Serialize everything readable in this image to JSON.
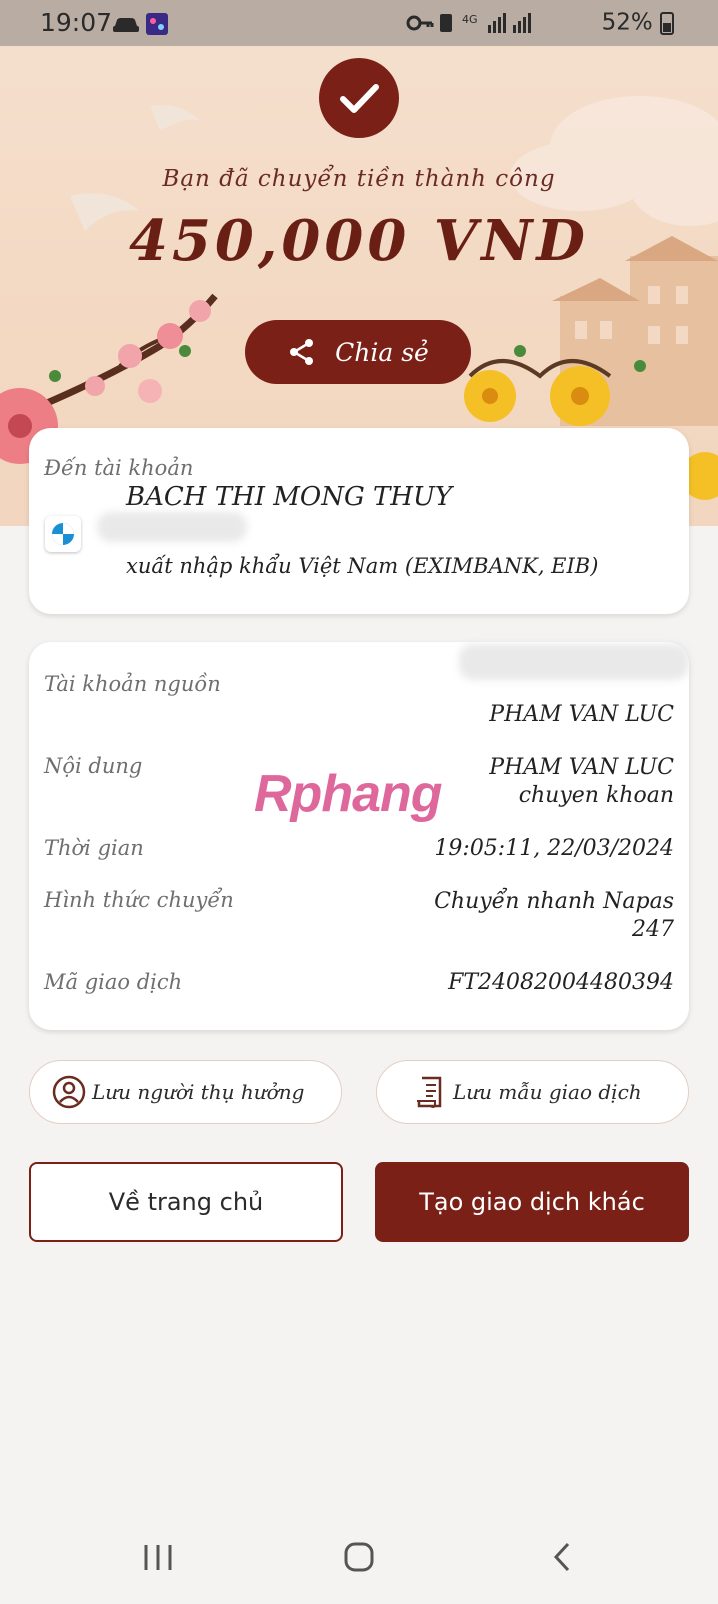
{
  "status_bar": {
    "time": "19:07",
    "network": "4G",
    "battery": "52%",
    "icons": [
      "car-icon",
      "app-icon",
      "key-icon",
      "sim-icon",
      "signal-icon",
      "battery-icon"
    ]
  },
  "hero": {
    "success_text": "Bạn đã chuyển tiền thành công",
    "amount": "450,000 VND",
    "share_label": "Chia sẻ"
  },
  "recipient": {
    "section_label": "Đến tài khoản",
    "name": "BACH THI MONG THUY",
    "bank": "xuất nhập khẩu Việt Nam (EXIMBANK, EIB)"
  },
  "details": [
    {
      "label": "Tài khoản nguồn",
      "value": "PHAM VAN LUC"
    },
    {
      "label": "Nội dung",
      "value": "PHAM VAN LUC chuyen khoan"
    },
    {
      "label": "Thời gian",
      "value": "19:05:11, 22/03/2024"
    },
    {
      "label": "Hình thức chuyển",
      "value": "Chuyển nhanh Napas 247"
    },
    {
      "label": "Mã giao dịch",
      "value": "FT24082004480394"
    }
  ],
  "watermark": "Rphang",
  "actions": {
    "save_beneficiary": "Lưu người thụ hưởng",
    "save_template": "Lưu mẫu giao dịch",
    "home": "Về trang chủ",
    "new_transaction": "Tạo giao dịch khác"
  },
  "colors": {
    "brand": "#7a2017",
    "hero_bg": "#f3d9c3",
    "page_bg": "#f4f3f2"
  }
}
